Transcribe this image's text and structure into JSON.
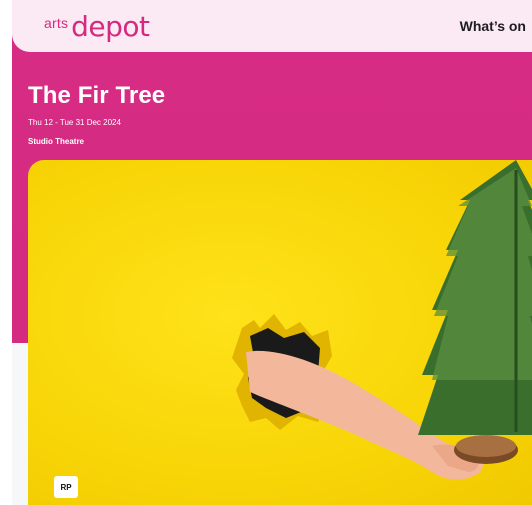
{
  "header": {
    "logo_arts": "arts",
    "logo_depot": "depot",
    "nav_whats_on": "What’s on"
  },
  "event": {
    "title": "The Fir Tree",
    "dates": "Thu 12 - Tue 31 Dec 2024",
    "venue": "Studio Theatre",
    "rating_badge": "RP"
  },
  "colors": {
    "brand_pink": "#d42a80",
    "header_bg": "#fbe9f3",
    "hero_yellow": "#f7d507"
  },
  "icons": {
    "hero_image": "hand-holding-fir-tree-through-paper-hole"
  }
}
